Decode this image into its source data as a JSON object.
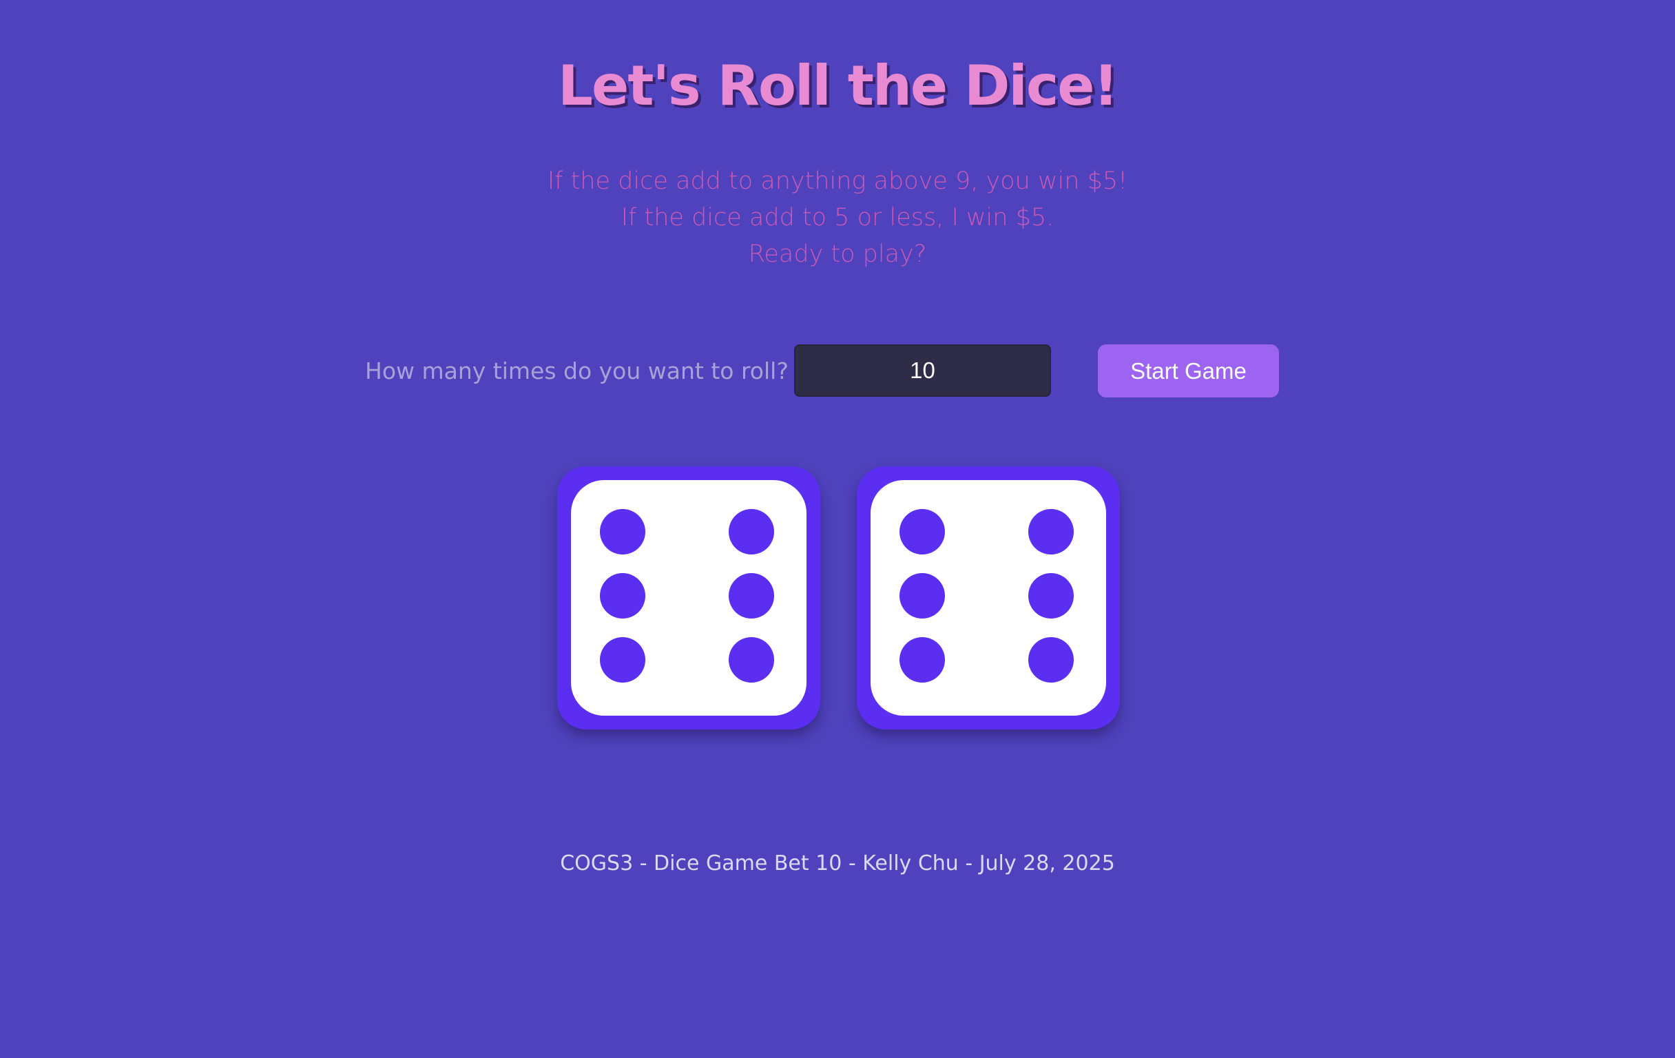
{
  "page": {
    "title": "Let's Roll the Dice!",
    "rules": [
      "If the dice add to anything above 9, you win $5!",
      "If the dice add to 5 or less, I win $5.",
      "Ready to play?"
    ]
  },
  "controls": {
    "roll_prompt": "How many times do you want to roll?",
    "roll_count_value": "10",
    "start_button_label": "Start Game"
  },
  "dice": [
    {
      "value": 6
    },
    {
      "value": 6
    }
  ],
  "footer": {
    "text": "COGS3 - Dice Game Bet 10 - Kelly Chu - July 28, 2025"
  },
  "colors": {
    "background": "#4f42bc",
    "title": "#e98bd3",
    "rules_text": "#c85ab6",
    "button": "#9d63f1",
    "die_body": "#5b2ef2",
    "die_face": "#ffffff"
  }
}
